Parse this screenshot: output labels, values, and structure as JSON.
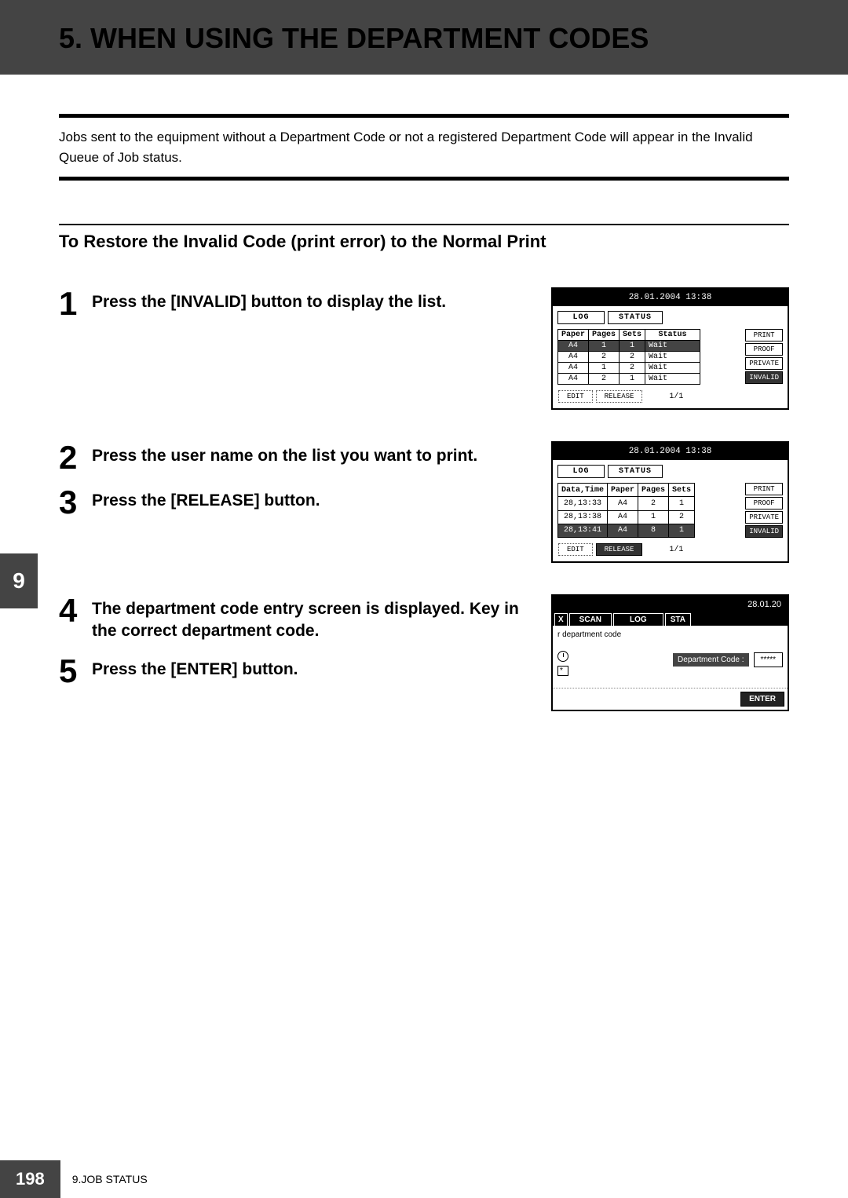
{
  "page": {
    "title": "5. WHEN USING THE DEPARTMENT CODES",
    "intro": "Jobs sent to the equipment without a Department Code or not a registered Department Code will appear in the Invalid Queue of Job status.",
    "subsection": "To Restore the Invalid Code (print error) to the Normal Print"
  },
  "steps": {
    "s1": {
      "num": "1",
      "text": "Press the [INVALID] button to display the list."
    },
    "s2": {
      "num": "2",
      "text": "Press the user name on the list you want to print."
    },
    "s3": {
      "num": "3",
      "text": "Press the [RELEASE] button."
    },
    "s4": {
      "num": "4",
      "text": "The department code entry screen is displayed. Key in the correct department code."
    },
    "s5": {
      "num": "5",
      "text": "Press the [ENTER] button."
    }
  },
  "screen1": {
    "datetime": "28.01.2004 13:38",
    "tabs": {
      "log": "LOG",
      "status": "STATUS"
    },
    "headers": {
      "paper": "Paper",
      "pages": "Pages",
      "sets": "Sets",
      "status": "Status"
    },
    "rows": [
      {
        "paper": "A4",
        "pages": "1",
        "sets": "1",
        "status": "Wait"
      },
      {
        "paper": "A4",
        "pages": "2",
        "sets": "2",
        "status": "Wait"
      },
      {
        "paper": "A4",
        "pages": "1",
        "sets": "2",
        "status": "Wait"
      },
      {
        "paper": "A4",
        "pages": "2",
        "sets": "1",
        "status": "Wait"
      }
    ],
    "sidebtns": {
      "print": "PRINT",
      "proof": "PROOF",
      "private": "PRIVATE",
      "invalid": "INVALID"
    },
    "bottom": {
      "edit": "EDIT",
      "release": "RELEASE",
      "page": "1/1"
    }
  },
  "screen2": {
    "datetime": "28.01.2004 13:38",
    "tabs": {
      "log": "LOG",
      "status": "STATUS"
    },
    "headers": {
      "datetime": "Data,Time",
      "paper": "Paper",
      "pages": "Pages",
      "sets": "Sets"
    },
    "rows": [
      {
        "datetime": "28,13:33",
        "paper": "A4",
        "pages": "2",
        "sets": "1",
        "selected": false
      },
      {
        "datetime": "28,13:38",
        "paper": "A4",
        "pages": "1",
        "sets": "2",
        "selected": false
      },
      {
        "datetime": "28,13:41",
        "paper": "A4",
        "pages": "8",
        "sets": "1",
        "selected": true
      }
    ],
    "sidebtns": {
      "print": "PRINT",
      "proof": "PROOF",
      "private": "PRIVATE",
      "invalid": "INVALID"
    },
    "bottom": {
      "edit": "EDIT",
      "release": "RELEASE",
      "page": "1/1"
    }
  },
  "screen3": {
    "datetime": "28.01.20",
    "tabs": {
      "x": "X",
      "scan": "SCAN",
      "log": "LOG",
      "sta": "STA"
    },
    "prompt": "r department code",
    "code_label": "Department Code :",
    "code_value": "*****",
    "enter": "ENTER",
    "star": "*"
  },
  "sidetab": "9",
  "footer": {
    "page": "198",
    "text": "9.JOB STATUS"
  }
}
